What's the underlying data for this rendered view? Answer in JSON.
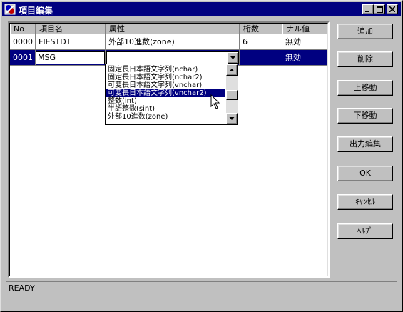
{
  "window": {
    "title": "項目編集",
    "controls": [
      "minimize-icon",
      "maximize-icon",
      "close-icon"
    ]
  },
  "grid": {
    "columns": [
      "No",
      "項目名",
      "属性",
      "桁数",
      "ナル値"
    ],
    "rows": [
      {
        "no": "0000",
        "name": "FIESTDT",
        "type": "外部10進数(zone)",
        "digits": "6",
        "null": "無効"
      },
      {
        "no": "0001",
        "name": "MSG",
        "type": "",
        "digits": "",
        "null": "無効"
      }
    ]
  },
  "dropdown": {
    "options": [
      "固定長日本語文字列(nchar)",
      "固定長日本語文字列(nchar2)",
      "可変長日本語文字列(vnchar)",
      "可変長日本語文字列(vnchar2)",
      "整数(int)",
      "半語整数(sint)",
      "外部10進数(zone)"
    ],
    "highlighted_index": 3
  },
  "buttons": {
    "add": "追加",
    "delete": "削除",
    "move_up": "上移動",
    "move_down": "下移動",
    "output_edit": "出力編集",
    "ok": "OK",
    "cancel": "ｷｬﾝｾﾙ",
    "help": "ﾍﾙﾌﾟ"
  },
  "status": {
    "text": "READY"
  },
  "colors": {
    "selection": "#000080",
    "face": "#c0c0c0"
  }
}
